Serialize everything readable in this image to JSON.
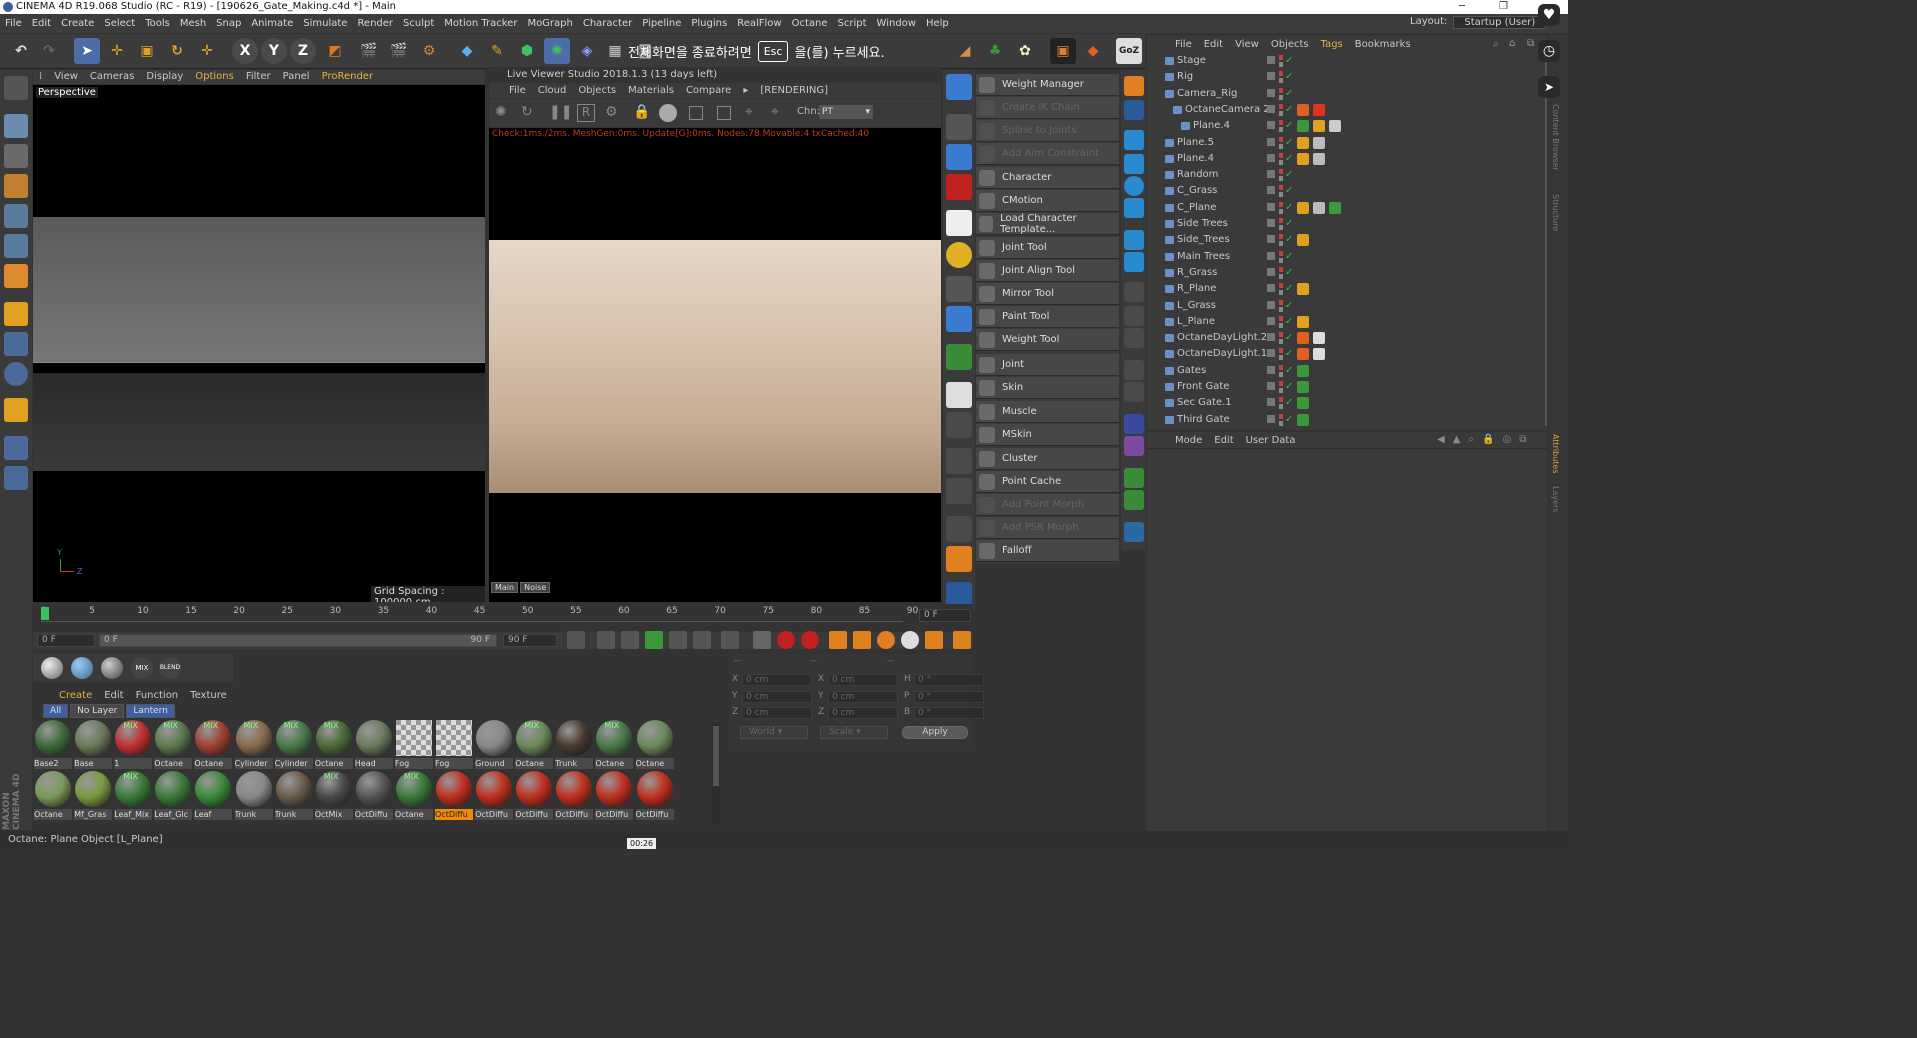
{
  "window": {
    "title": "CINEMA 4D R19.068 Studio (RC - R19) - [190626_Gate_Making.c4d *] - Main",
    "layout_label": "Layout:",
    "layout_value": "Startup (User)"
  },
  "menubar": [
    "File",
    "Edit",
    "Create",
    "Select",
    "Tools",
    "Mesh",
    "Snap",
    "Animate",
    "Simulate",
    "Render",
    "Sculpt",
    "Motion Tracker",
    "MoGraph",
    "Character",
    "Pipeline",
    "Plugins",
    "RealFlow",
    "Octane",
    "Script",
    "Window",
    "Help"
  ],
  "overlay": {
    "prefix": "전체화면을 종료하려면",
    "key": "Esc",
    "suffix": "을(를) 누르세요."
  },
  "viewport": {
    "menu": [
      "View",
      "Cameras",
      "Display",
      "Options",
      "Filter",
      "Panel",
      "ProRender"
    ],
    "label": "Perspective",
    "grid_spacing": "Grid Spacing : 100000 cm",
    "axis_y": "Y",
    "axis_z": "Z"
  },
  "live_viewer": {
    "title": "Live Viewer Studio 2018.1.3 (13 days left)",
    "menu": [
      "File",
      "Cloud",
      "Objects",
      "Materials",
      "Compare"
    ],
    "rendering": "[RENDERING]",
    "chn_label": "Chn:",
    "chn_value": "PT",
    "status": "Check:1ms./2ms. MeshGen:0ms. Update[G]:0ms. Nodes:78 Movable:4 txCached:40",
    "tabs": [
      "Main",
      "Noise"
    ]
  },
  "character_menu": [
    {
      "label": "Weight Manager",
      "enabled": true
    },
    {
      "label": "Create IK Chain",
      "enabled": false
    },
    {
      "label": "Spline to Joints",
      "enabled": false
    },
    {
      "label": "Add Aim Constraint",
      "enabled": false
    },
    {
      "label": "Character",
      "enabled": true
    },
    {
      "label": "CMotion",
      "enabled": true
    },
    {
      "label": "Load Character Template...",
      "enabled": true
    },
    {
      "label": "Joint Tool",
      "enabled": true
    },
    {
      "label": "Joint Align Tool",
      "enabled": true
    },
    {
      "label": "Mirror Tool",
      "enabled": true
    },
    {
      "label": "Paint Tool",
      "enabled": true
    },
    {
      "label": "Weight Tool",
      "enabled": true
    },
    {
      "label": "Joint",
      "enabled": true
    },
    {
      "label": "Skin",
      "enabled": true
    },
    {
      "label": "Muscle",
      "enabled": true
    },
    {
      "label": "MSkin",
      "enabled": true
    },
    {
      "label": "Cluster",
      "enabled": true
    },
    {
      "label": "Point Cache",
      "enabled": true
    },
    {
      "label": "Add Point Morph",
      "enabled": false
    },
    {
      "label": "Add PSR Morph",
      "enabled": false
    },
    {
      "label": "Falloff",
      "enabled": true
    }
  ],
  "object_manager": {
    "menu": [
      "File",
      "Edit",
      "View",
      "Objects",
      "Tags",
      "Bookmarks"
    ],
    "objects": [
      "Stage",
      "Rig",
      "Camera_Rig",
      "OctaneCamera 2",
      "Plane.4",
      "Plane.5",
      "Plane.4",
      "Random",
      "C_Grass",
      "C_Plane",
      "Side Trees",
      "Side_Trees",
      "Main Trees",
      "R_Grass",
      "R_Plane",
      "L_Grass",
      "L_Plane",
      "OctaneDayLight.2",
      "OctaneDayLight.1",
      "Gates",
      "Front Gate",
      "Sec Gate.1",
      "Third Gate"
    ]
  },
  "attributes": {
    "menu": [
      "Mode",
      "Edit",
      "User Data"
    ]
  },
  "right_tabs": [
    "Content Browser",
    "Structure",
    "Attributes",
    "Layers"
  ],
  "timeline": {
    "ticks": [
      "0",
      "5",
      "10",
      "15",
      "20",
      "25",
      "30",
      "35",
      "40",
      "45",
      "50",
      "55",
      "60",
      "65",
      "70",
      "75",
      "80",
      "85",
      "90"
    ],
    "end_field": "0 F",
    "start_frame": "0 F",
    "min_field": "0 F",
    "max_field": "90 F",
    "max_frame": "90 F"
  },
  "material_manager": {
    "menu": [
      "Create",
      "Edit",
      "Function",
      "Texture"
    ],
    "tabs": [
      "All",
      "No Layer",
      "Lantern"
    ],
    "row1": [
      "Base2",
      "Base",
      "1",
      "Octane",
      "Octane",
      "Cylinder",
      "Cylinder",
      "Octane",
      "Head",
      "Fog",
      "Fog",
      "Ground",
      "Octane",
      "Trunk",
      "Octane",
      "Octane"
    ],
    "row2": [
      "Octane",
      "Mf_Gras",
      "Leaf_Mix",
      "Leaf_Glc",
      "Leaf",
      "Trunk",
      "Trunk",
      "OctMix",
      "OctDiffu",
      "Octane",
      "OctDiffu",
      "OctDiffu",
      "OctDiffu",
      "OctDiffu",
      "OctDiffu",
      "OctDiffu"
    ]
  },
  "coordinates": {
    "header": [
      "--",
      "--",
      "--"
    ],
    "rows": [
      {
        "a": "X",
        "av": "0 cm",
        "b": "X",
        "bv": "0 cm",
        "c": "H",
        "cv": "0 °"
      },
      {
        "a": "Y",
        "av": "0 cm",
        "b": "Y",
        "bv": "0 cm",
        "c": "P",
        "cv": "0 °"
      },
      {
        "a": "Z",
        "av": "0 cm",
        "b": "Z",
        "bv": "0 cm",
        "c": "B",
        "cv": "0 °"
      }
    ],
    "mode": "World",
    "scale": "Scale",
    "apply": "Apply"
  },
  "status": {
    "text": "Octane:     Plane Object [L_Plane]",
    "time": "00:26"
  },
  "brand": "MAXON CINEMA 4D"
}
